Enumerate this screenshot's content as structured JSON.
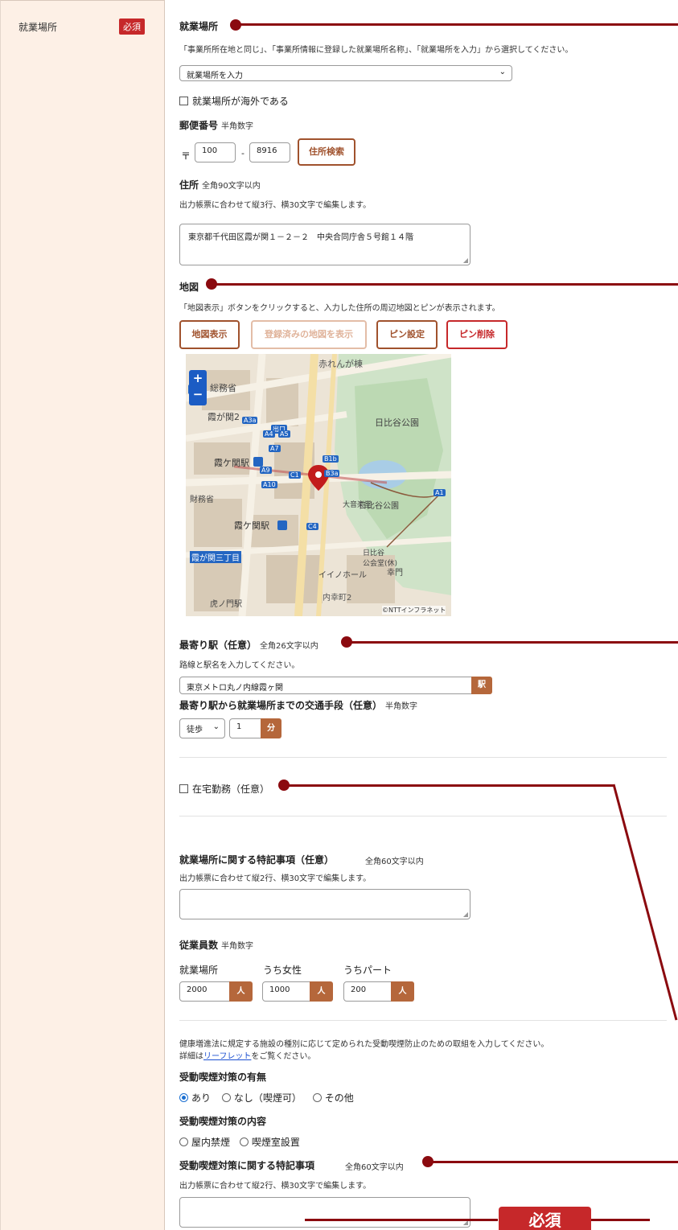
{
  "sidebar": {
    "label": "就業場所",
    "required": "必須"
  },
  "workplace": {
    "heading": "就業場所",
    "instruction": "「事業所所在地と同じ」、「事業所情報に登録した就業場所名称」、「就業場所を入力」から選択してください。",
    "select_value": "就業場所を入力",
    "overseas_label": "就業場所が海外である"
  },
  "postal": {
    "heading": "郵便番号",
    "hint": "半角数字",
    "prefix": "〒",
    "part1": "100",
    "dash": "-",
    "part2": "8916",
    "search_button": "住所検索"
  },
  "address": {
    "heading": "住所",
    "hint": "全角90文字以内",
    "note": "出力帳票に合わせて縦3行、横30文字で編集します。",
    "value": "東京都千代田区霞が関１－２－２　中央合同庁舎５号館１４階"
  },
  "map": {
    "heading": "地図",
    "note": "「地図表示」ボタンをクリックすると、入力した住所の周辺地図とピンが表示されます。",
    "buttons": {
      "show": "地図表示",
      "show_registered": "登録済みの地図を表示",
      "set_pin": "ピン設定",
      "delete_pin": "ピン削除"
    },
    "zoom_in": "+",
    "zoom_out": "−",
    "labels": {
      "akarenga": "赤れんが棟",
      "soumusho": "総務省",
      "kasumigaseki2": "霞が関2",
      "hibiya_park": "日比谷公園",
      "kasumigaseki_station": "霞ケ関駅",
      "kasumigaseki_station2": "霞ケ関駅",
      "zaimusho": "財務省",
      "daiongakudo": "大音楽堂",
      "hibiya_park2": "日比谷公園",
      "kasumigaseki3": "霞が関三丁目",
      "kokaido": "日比谷\n公会堂(休)",
      "saiwaimon": "幸門",
      "iino": "イイノホール",
      "uchisaiwai": "内幸町2",
      "toranomon": "虎ノ門駅",
      "credit": "©NTTインフラネット",
      "exits": [
        "A3a",
        "出口",
        "A4",
        "A5",
        "A7",
        "A9",
        "A10",
        "B1b",
        "B3a",
        "C1",
        "C4",
        "A1"
      ]
    }
  },
  "station": {
    "heading": "最寄り駅（任意）",
    "hint": "全角26文字以内",
    "note": "路線と駅名を入力してください。",
    "value": "東京メトロ丸ノ内線霞ヶ関",
    "addon": "駅"
  },
  "transport": {
    "heading": "最寄り駅から就業場所までの交通手段（任意）",
    "hint": "半角数字",
    "mode": "徒歩",
    "minutes": "1",
    "unit": "分"
  },
  "remote": {
    "label": "在宅勤務（任意）"
  },
  "remarks": {
    "heading": "就業場所に関する特記事項（任意）",
    "hint": "全角60文字以内",
    "note": "出力帳票に合わせて縦2行、横30文字で編集します。",
    "value": ""
  },
  "employees": {
    "heading": "従業員数",
    "hint": "半角数字",
    "col1": "就業場所",
    "col2": "うち女性",
    "col3": "うちパート",
    "val1": "2000",
    "val2": "1000",
    "val3": "200",
    "unit": "人"
  },
  "smoking": {
    "intro1": "健康増進法に規定する施設の種別に応じて定められた受動喫煙防止のための取組を入力してください。",
    "intro2_prefix": "詳細は",
    "leaflet_link": "リーフレット",
    "intro2_suffix": "をご覧ください。",
    "presence_heading": "受動喫煙対策の有無",
    "presence_options": [
      "あり",
      "なし（喫煙可）",
      "その他"
    ],
    "content_heading": "受動喫煙対策の内容",
    "content_options": [
      "屋内禁煙",
      "喫煙室設置"
    ],
    "remarks_heading": "受動喫煙対策に関する特記事項",
    "remarks_hint": "全角60文字以内",
    "remarks_note": "出力帳票に合わせて縦2行、横30文字で編集します。",
    "remarks_value": ""
  },
  "callout": {
    "label": "必須"
  }
}
